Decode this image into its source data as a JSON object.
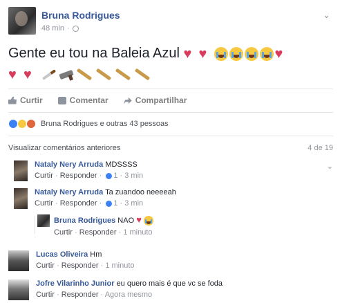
{
  "post": {
    "author": "Bruna Rodrigues",
    "time": "48 min",
    "separator": "·",
    "text": "Gente eu tou na Baleia Azul"
  },
  "actions": {
    "like": "Curtir",
    "comment": "Comentar",
    "share": "Compartilhar"
  },
  "reactions": {
    "text": "Bruna Rodrigues e outras 43 pessoas"
  },
  "comments_header": {
    "prev_label": "Visualizar comentários anteriores",
    "count": "4 de 19"
  },
  "comments": [
    {
      "name": "Nataly Nery Arruda",
      "text": "MDSSSS",
      "like": "Curtir",
      "reply": "Responder",
      "likes": "1",
      "time": "3 min"
    },
    {
      "name": "Nataly Nery Arruda",
      "text": "Ta zuandoo neeeeah",
      "like": "Curtir",
      "reply": "Responder",
      "likes": "1",
      "time": "3 min"
    },
    {
      "name": "Bruna Rodrigues",
      "text": "NAO",
      "like": "Curtir",
      "reply": "Responder",
      "time": "1 minuto"
    },
    {
      "name": "Lucas Oliveira",
      "text": "Hm",
      "like": "Curtir",
      "reply": "Responder",
      "time": "1 minuto"
    },
    {
      "name": "Jofre Vilarinho Junior",
      "text": "eu quero mais é que vc se foda",
      "like": "Curtir",
      "reply": "Responder",
      "time": "Agora mesmo"
    }
  ],
  "sep": "·"
}
